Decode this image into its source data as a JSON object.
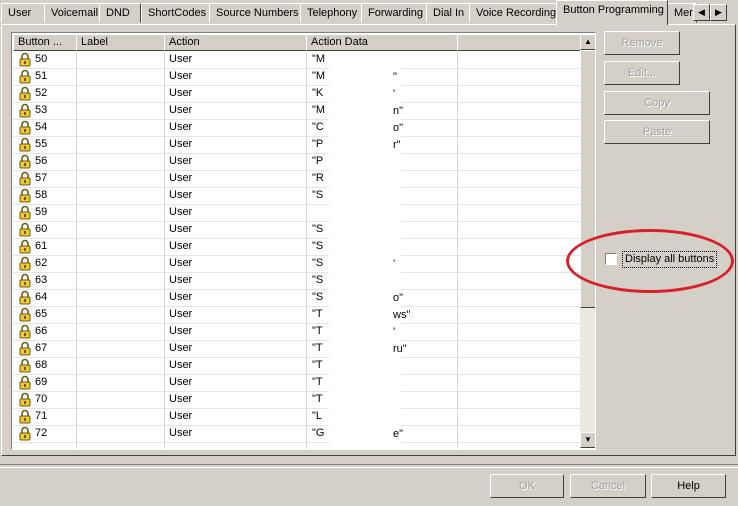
{
  "tabs": [
    {
      "label": "User"
    },
    {
      "label": "Voicemail"
    },
    {
      "label": "DND"
    },
    {
      "label": "ShortCodes"
    },
    {
      "label": "Source Numbers"
    },
    {
      "label": "Telephony"
    },
    {
      "label": "Forwarding"
    },
    {
      "label": "Dial In"
    },
    {
      "label": "Voice Recording"
    },
    {
      "label": "Button Programming"
    },
    {
      "label": "Menu"
    }
  ],
  "columns": [
    "Button ...",
    "Label",
    "Action",
    "Action Data"
  ],
  "rows": [
    {
      "num": "50",
      "action": "User",
      "data": "\"M"
    },
    {
      "num": "51",
      "action": "User",
      "data": "\"M"
    },
    {
      "num": "52",
      "action": "User",
      "data": "\"K"
    },
    {
      "num": "53",
      "action": "User",
      "data": "\"M"
    },
    {
      "num": "54",
      "action": "User",
      "data": "\"C"
    },
    {
      "num": "55",
      "action": "User",
      "data": "\"P"
    },
    {
      "num": "56",
      "action": "User",
      "data": "\"P"
    },
    {
      "num": "57",
      "action": "User",
      "data": "\"R"
    },
    {
      "num": "58",
      "action": "User",
      "data": "\"S"
    },
    {
      "num": "59",
      "action": "User",
      "data": ""
    },
    {
      "num": "60",
      "action": "User",
      "data": "\"S"
    },
    {
      "num": "61",
      "action": "User",
      "data": "\"S"
    },
    {
      "num": "62",
      "action": "User",
      "data": "\"S"
    },
    {
      "num": "63",
      "action": "User",
      "data": "\"S"
    },
    {
      "num": "64",
      "action": "User",
      "data": "\"S"
    },
    {
      "num": "65",
      "action": "User",
      "data": "\"T"
    },
    {
      "num": "66",
      "action": "User",
      "data": "\"T"
    },
    {
      "num": "67",
      "action": "User",
      "data": "\"T"
    },
    {
      "num": "68",
      "action": "User",
      "data": "\"T"
    },
    {
      "num": "69",
      "action": "User",
      "data": "\"T"
    },
    {
      "num": "70",
      "action": "User",
      "data": "\"T"
    },
    {
      "num": "71",
      "action": "User",
      "data": "\"L"
    },
    {
      "num": "72",
      "action": "User",
      "data": "\"G"
    }
  ],
  "data_tails": [
    {
      "row": 1,
      "text": "\""
    },
    {
      "row": 2,
      "text": "'"
    },
    {
      "row": 3,
      "text": "n\""
    },
    {
      "row": 4,
      "text": "o\""
    },
    {
      "row": 5,
      "text": "r\""
    },
    {
      "row": 12,
      "text": "'"
    },
    {
      "row": 14,
      "text": "o\""
    },
    {
      "row": 15,
      "text": "ws\""
    },
    {
      "row": 16,
      "text": "'"
    },
    {
      "row": 17,
      "text": "ru\""
    },
    {
      "row": 22,
      "text": "e\""
    }
  ],
  "buttons": {
    "remove": "Remove",
    "edit": "Edit...",
    "copy": "Copy",
    "paste": "Paste",
    "ok": "OK",
    "cancel": "Cancel",
    "help": "Help"
  },
  "display_all_label": "Display all buttons",
  "display_all_checked": false,
  "annotation_color": "#d8202a"
}
